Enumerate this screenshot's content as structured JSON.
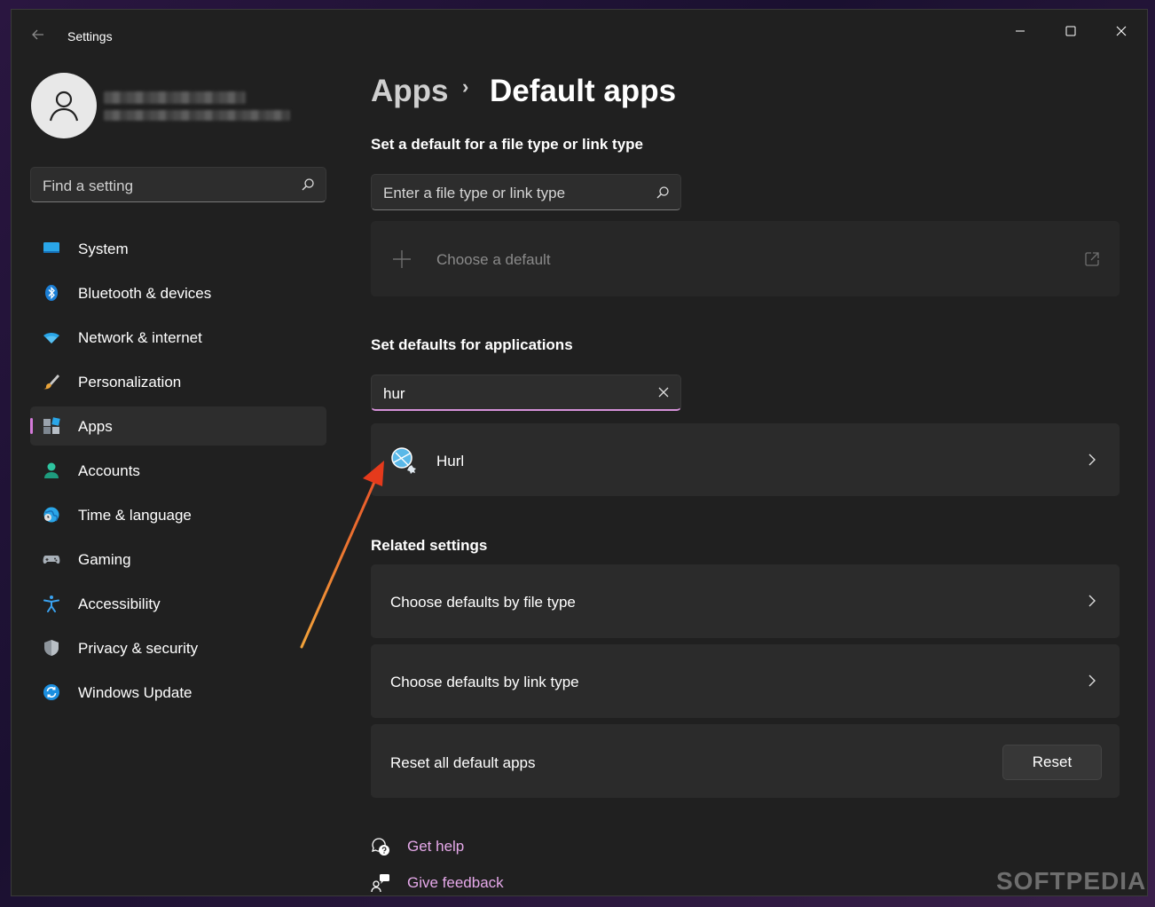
{
  "window": {
    "title": "Settings"
  },
  "search": {
    "placeholder": "Find a setting"
  },
  "sidebar": {
    "items": [
      {
        "label": "System",
        "icon": "system-icon"
      },
      {
        "label": "Bluetooth & devices",
        "icon": "bluetooth-icon"
      },
      {
        "label": "Network & internet",
        "icon": "wifi-icon"
      },
      {
        "label": "Personalization",
        "icon": "brush-icon"
      },
      {
        "label": "Apps",
        "icon": "apps-icon",
        "selected": true
      },
      {
        "label": "Accounts",
        "icon": "person-icon"
      },
      {
        "label": "Time & language",
        "icon": "globe-clock-icon"
      },
      {
        "label": "Gaming",
        "icon": "gamepad-icon"
      },
      {
        "label": "Accessibility",
        "icon": "accessibility-icon"
      },
      {
        "label": "Privacy & security",
        "icon": "shield-icon"
      },
      {
        "label": "Windows Update",
        "icon": "refresh-icon"
      }
    ]
  },
  "breadcrumb": {
    "parent": "Apps",
    "separator": "›",
    "current": "Default apps"
  },
  "filetype_section": {
    "title": "Set a default for a file type or link type",
    "input_placeholder": "Enter a file type or link type",
    "choose_default_label": "Choose a default"
  },
  "apps_section": {
    "title": "Set defaults for applications",
    "search_value": "hur",
    "results": [
      {
        "name": "Hurl",
        "icon": "hurl-app-icon"
      }
    ]
  },
  "related": {
    "title": "Related settings",
    "items": [
      {
        "label": "Choose defaults by file type"
      },
      {
        "label": "Choose defaults by link type"
      }
    ],
    "reset_label": "Reset all default apps",
    "reset_button": "Reset"
  },
  "footer": {
    "get_help": "Get help",
    "give_feedback": "Give feedback"
  },
  "watermark": "SOFTPEDIA",
  "colors": {
    "accent": "#d591d8",
    "link": "#e6a9ea",
    "background": "#202020",
    "card": "#2b2b2b"
  }
}
